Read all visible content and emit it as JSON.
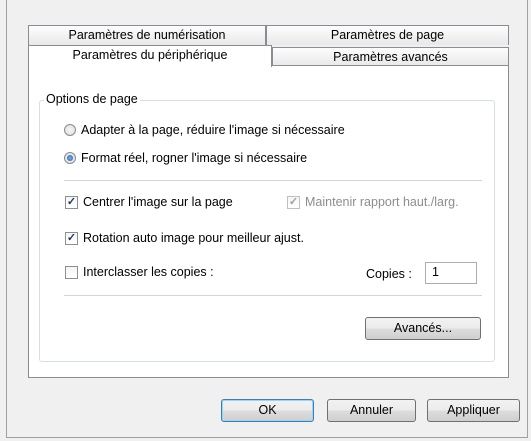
{
  "tabs": {
    "back_row": [
      "Paramètres de numérisation",
      "Paramètres de page"
    ],
    "front_row": [
      "Paramètres du périphérique",
      "Paramètres avancés"
    ]
  },
  "group": {
    "title": "Options de page"
  },
  "options": {
    "fit_page": {
      "label": "Adapter à la page, réduire l'image si nécessaire",
      "selected": false
    },
    "actual_size": {
      "label": "Format réel, rogner l'image si nécessaire",
      "selected": true
    },
    "center_image": {
      "label": "Centrer l'image sur la page",
      "checked": true
    },
    "keep_ratio": {
      "label": "Maintenir rapport haut./larg.",
      "checked": true,
      "disabled": true
    },
    "auto_rotate": {
      "label": "Rotation auto image pour meilleur ajust.",
      "checked": true
    },
    "collate": {
      "label": "Interclasser les copies :",
      "checked": false
    }
  },
  "copies": {
    "label": "Copies :",
    "value": "1"
  },
  "buttons": {
    "advanced": "Avancés...",
    "ok": "OK",
    "cancel": "Annuler",
    "apply": "Appliquer"
  }
}
